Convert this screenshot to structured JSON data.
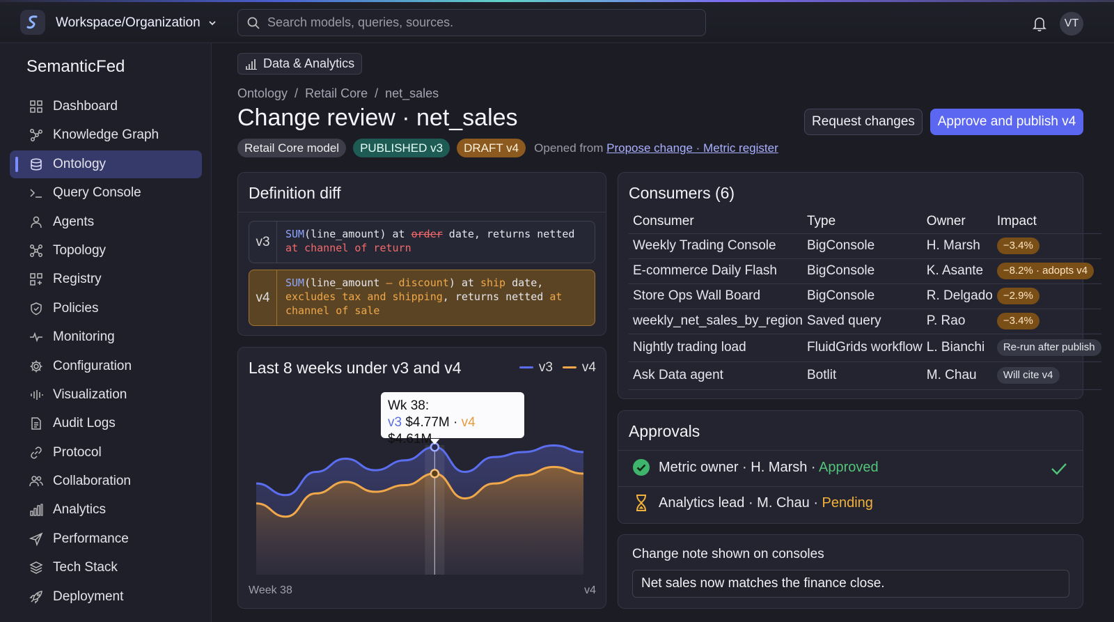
{
  "header": {
    "workspace": "Workspace/Organization",
    "search_placeholder": "Search models, queries, sources.",
    "avatar": "VT",
    "icons": [
      "logo-icon",
      "chevron-down-icon",
      "search-icon",
      "bell-icon"
    ]
  },
  "sidebar": {
    "brand": "SemanticFed",
    "items": [
      {
        "label": "Dashboard",
        "icon": "grid-icon"
      },
      {
        "label": "Knowledge Graph",
        "icon": "graph-icon"
      },
      {
        "label": "Ontology",
        "icon": "database-icon",
        "active": true
      },
      {
        "label": "Query Console",
        "icon": "terminal-icon"
      },
      {
        "label": "Agents",
        "icon": "agents-icon"
      },
      {
        "label": "Topology",
        "icon": "topology-icon"
      },
      {
        "label": "Registry",
        "icon": "registry-icon"
      },
      {
        "label": "Policies",
        "icon": "shield-icon"
      },
      {
        "label": "Monitoring",
        "icon": "pulse-icon"
      },
      {
        "label": "Configuration",
        "icon": "gear-icon"
      },
      {
        "label": "Visualization",
        "icon": "bars-icon"
      },
      {
        "label": "Audit Logs",
        "icon": "document-icon"
      },
      {
        "label": "Protocol",
        "icon": "link-icon"
      },
      {
        "label": "Collaboration",
        "icon": "users-icon"
      },
      {
        "label": "Analytics",
        "icon": "chart-icon"
      },
      {
        "label": "Performance",
        "icon": "send-icon"
      },
      {
        "label": "Tech Stack",
        "icon": "layers-icon"
      },
      {
        "label": "Deployment",
        "icon": "rocket-icon"
      }
    ]
  },
  "main": {
    "section_tag": "Data & Analytics",
    "breadcrumb": [
      "Ontology",
      "Retail Core",
      "net_sales"
    ],
    "breadcrumb_sep": "/",
    "title": "Change review · net_sales",
    "badges": {
      "model": "Retail Core model",
      "published": "PUBLISHED v3",
      "draft": "DRAFT v4"
    },
    "opened_prefix": "Opened from",
    "opened_link": "Propose change · Metric register",
    "request_changes": "Request changes",
    "approve": "Approve and publish v4"
  },
  "diff": {
    "title": "Definition diff",
    "v3_label": "v3",
    "v4_label": "v4",
    "v3": {
      "fn": "SUM",
      "arg": "(line_amount) at ",
      "removed": "order",
      "rest": " date, returns netted",
      "tail": "at channel of return"
    },
    "v4": {
      "fn": "SUM",
      "arg_a": "(line_amount ",
      "added_a": "– discount",
      "arg_b": ") at ",
      "added_b": "ship",
      "rest_a": " date,",
      "added_c": "excludes tax and shipping",
      "rest_b": ", returns netted ",
      "added_d": "at",
      "added_e": "channel of sale"
    }
  },
  "chart": {
    "title": "Last 8 weeks under v3 and v4",
    "legend_v3": "v3",
    "legend_v4": "v4",
    "tooltip_title": "Wk 38:",
    "tooltip_v3_label": "v3",
    "tooltip_v3_value": "$4.77M",
    "tooltip_sep": "·",
    "tooltip_v4_label": "v4",
    "tooltip_v4_value": "$4.61M",
    "x_left": "Week 38",
    "x_right": "v4",
    "colors": {
      "v3": "#5b6ef0",
      "v4": "#f0a84a"
    }
  },
  "chart_data": {
    "type": "area",
    "title": "Last 8 weeks under v3 and v4",
    "x": [
      "",
      "",
      "",
      "",
      "",
      "",
      "",
      "",
      "",
      "",
      "",
      ""
    ],
    "series": [
      {
        "name": "v3",
        "values": [
          4.55,
          4.48,
          4.62,
          4.7,
          4.63,
          4.69,
          4.77,
          4.62,
          4.71,
          4.74,
          4.78,
          4.74
        ]
      },
      {
        "name": "v4",
        "values": [
          4.43,
          4.35,
          4.49,
          4.56,
          4.5,
          4.54,
          4.61,
          4.46,
          4.55,
          4.6,
          4.65,
          4.61
        ]
      }
    ],
    "highlight": {
      "label": "Wk 38",
      "index": 6,
      "v3": 4.77,
      "v4": 4.61
    },
    "ylim": [
      4.0,
      4.95
    ],
    "grid": false,
    "legend": "top-right"
  },
  "consumers": {
    "title": "Consumers (6)",
    "columns": [
      "Consumer",
      "Type",
      "Owner",
      "Impact"
    ],
    "rows": [
      {
        "consumer": "Weekly Trading Console",
        "type": "BigConsole",
        "owner": "H. Marsh",
        "impact": "−3.4%",
        "tone": "orange"
      },
      {
        "consumer": "E-commerce Daily Flash",
        "type": "BigConsole",
        "owner": "K. Asante",
        "impact": "−8.2% · adopts v4",
        "tone": "orange"
      },
      {
        "consumer": "Store Ops Wall Board",
        "type": "BigConsole",
        "owner": "R. Delgado",
        "impact": "−2.9%",
        "tone": "orange"
      },
      {
        "consumer": "weekly_net_sales_by_region",
        "type": "Saved query",
        "owner": "P. Rao",
        "impact": "−3.4%",
        "tone": "orange"
      },
      {
        "consumer": "Nightly trading load",
        "type": "FluidGrids workflow",
        "owner": "L. Bianchi",
        "impact": "Re-run after publish",
        "tone": "gray"
      },
      {
        "consumer": "Ask Data agent",
        "type": "Botlit",
        "owner": "M. Chau",
        "impact": "Will cite v4",
        "tone": "gray"
      }
    ]
  },
  "approvals": {
    "title": "Approvals",
    "rows": [
      {
        "role": "Metric owner · H. Marsh · ",
        "status": "Approved",
        "icon": "check-circle-icon"
      },
      {
        "role": "Analytics lead · M. Chau · ",
        "status": "Pending",
        "icon": "hourglass-icon"
      }
    ],
    "colors": {
      "approved": "#52c47a",
      "pending": "#f2b13a"
    }
  },
  "note": {
    "label": "Change note shown on consoles",
    "value": "Net sales now matches the finance close."
  }
}
